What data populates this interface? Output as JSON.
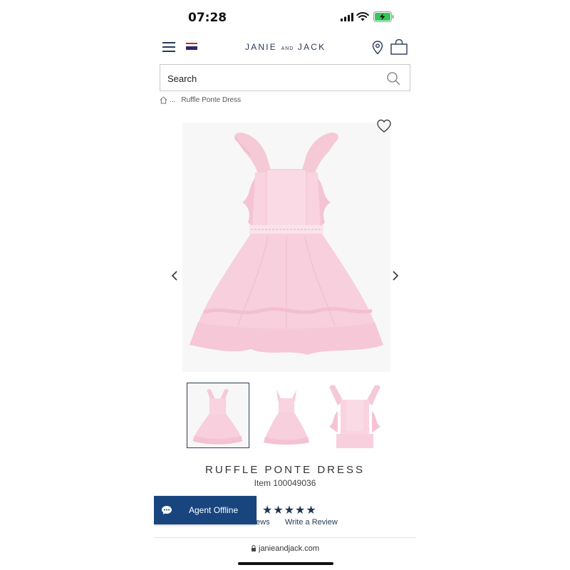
{
  "status_bar": {
    "time": "07:28"
  },
  "header": {
    "brand_main_left": "JANIE",
    "brand_and": "AND",
    "brand_main_right": "JACK",
    "icons": [
      "menu-icon",
      "flag-icon",
      "location-icon",
      "bag-icon"
    ]
  },
  "search": {
    "placeholder": "Search"
  },
  "breadcrumb": {
    "ellipsis": "...",
    "current": "Ruffle Ponte Dress"
  },
  "product": {
    "title": "RUFFLE PONTE DRESS",
    "item_number": "Item 100049036",
    "rating_stars": "★★★★★",
    "rating_value": 5,
    "reviews_text": "0 Reviews",
    "write_review": "Write a Review",
    "dress_color": "#f8cfdc",
    "thumbnail_count": 3,
    "active_thumbnail": 1
  },
  "chat": {
    "label": "Agent Offline"
  },
  "browser": {
    "url": "janieandjack.com"
  },
  "colors": {
    "brand_navy": "#2a3a55",
    "chat_blue": "#19457f",
    "battery_green": "#34c759"
  }
}
